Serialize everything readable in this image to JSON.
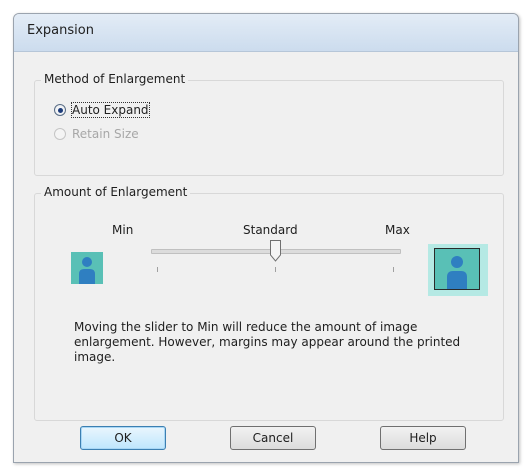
{
  "dialog": {
    "title": "Expansion"
  },
  "method_group": {
    "title": "Method of Enlargement",
    "options": [
      {
        "label": "Auto Expand",
        "selected": true,
        "enabled": true
      },
      {
        "label": "Retain Size",
        "selected": false,
        "enabled": false
      }
    ]
  },
  "amount_group": {
    "title": "Amount of Enlargement",
    "slider": {
      "min_label": "Min",
      "mid_label": "Standard",
      "max_label": "Max",
      "value_position": "Standard"
    },
    "description": "Moving the slider to Min will reduce the amount of image enlargement. However, margins may appear around the printed image."
  },
  "buttons": {
    "ok": "OK",
    "cancel": "Cancel",
    "help": "Help"
  },
  "colors": {
    "image_fill": "#59c0b6",
    "person_icon": "#2f7fc1",
    "large_bg": "#b5e9e4"
  },
  "icons": [
    "person-icon",
    "person-icon"
  ]
}
